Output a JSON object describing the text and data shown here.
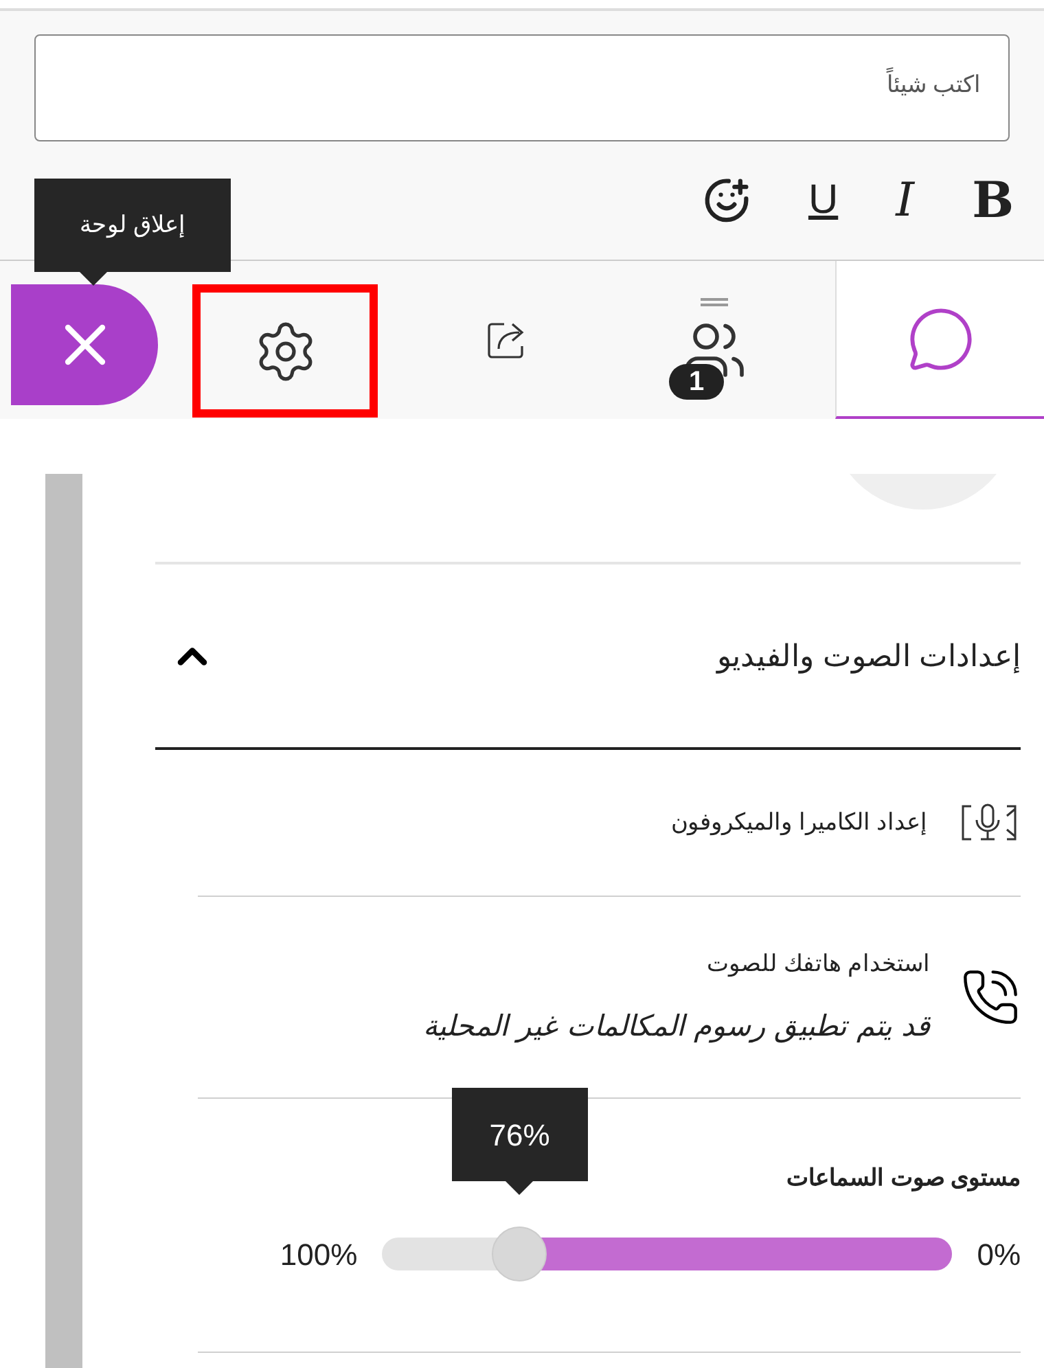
{
  "composer": {
    "placeholder": "اكتب شيئاً"
  },
  "format_buttons": [
    {
      "kind": "bold",
      "label": "B"
    },
    {
      "kind": "italic",
      "label": "I"
    },
    {
      "kind": "underline",
      "label": "U"
    },
    {
      "kind": "emoji"
    }
  ],
  "tabs": [
    {
      "kind": "chat",
      "selected": true
    },
    {
      "kind": "participants",
      "selected": false,
      "badge": "1"
    },
    {
      "kind": "share",
      "selected": false
    },
    {
      "kind": "settings",
      "selected": false,
      "highlighted": true
    },
    {
      "kind": "close",
      "selected": false
    }
  ],
  "tooltip": "إعلاق لوحة",
  "section": {
    "title": "إعدادات الصوت والفيديو",
    "expanded": true,
    "items": [
      {
        "kind": "camera",
        "title": "إعداد الكاميرا والميكروفون"
      },
      {
        "kind": "phone",
        "title": "استخدام هاتفك للصوت",
        "note": "قد يتم تطبيق رسوم المكالمات غير المحلية"
      }
    ],
    "volume": {
      "label": "مستوى صوت السماعات",
      "level": 0.76,
      "reading": "76%",
      "max_label": "100%",
      "min_label": "0%"
    }
  }
}
